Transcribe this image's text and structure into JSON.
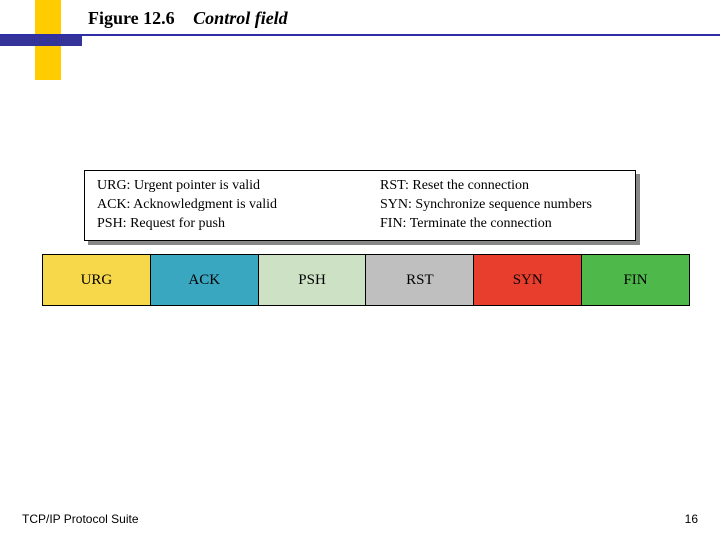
{
  "title": {
    "figure_number": "Figure 12.6",
    "caption": "Control field"
  },
  "legend": {
    "left": [
      "URG: Urgent pointer is valid",
      "ACK: Acknowledgment is valid",
      "PSH: Request for push"
    ],
    "right": [
      "RST: Reset the connection",
      "SYN: Synchronize sequence numbers",
      "FIN: Terminate the connection"
    ]
  },
  "flags": [
    "URG",
    "ACK",
    "PSH",
    "RST",
    "SYN",
    "FIN"
  ],
  "footer": {
    "left": "TCP/IP Protocol Suite",
    "right": "16"
  },
  "colors": {
    "accent_yellow": "#ffcc00",
    "accent_blue": "#333399",
    "urg": "#f7d84b",
    "ack": "#3aa7c0",
    "psh": "#cde2c4",
    "rst": "#bfbfbf",
    "syn": "#e83e2e",
    "fin": "#4fb84a"
  }
}
